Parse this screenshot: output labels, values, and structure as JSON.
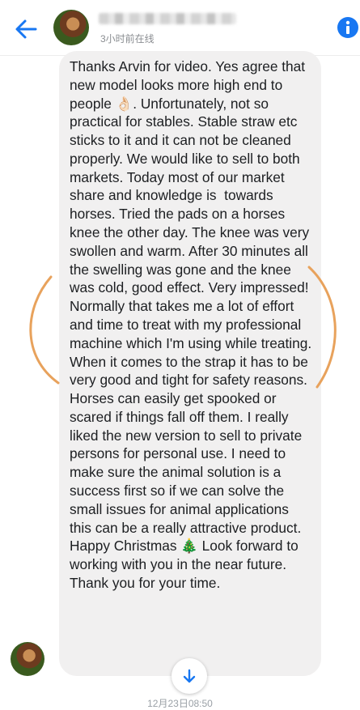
{
  "header": {
    "status": "3小时前在线",
    "back_icon": "back-arrow-icon",
    "info_icon": "info-icon",
    "accent_color": "#1877f2"
  },
  "message": {
    "text": "Thanks Arvin for video. Yes agree that new model looks more high end to people 👌🏻. Unfortunately, not so practical for stables. Stable straw etc sticks to it and it can not be cleaned properly. We would like to sell to both markets. Today most of our market share and knowledge is  towards horses. Tried the pads on a horses knee the other day. The knee was very swollen and warm. After 30 minutes all the swelling was gone and the knee was cold, good effect. Very impressed! Normally that takes me a lot of effort and time to treat with my professional machine which I'm using while treating.\nWhen it comes to the strap it has to be very good and tight for safety reasons. Horses can easily get spooked or scared if things fall off them. I really liked the new version to sell to private persons for personal use. I need to make sure the animal solution is a success first so if we can solve the small issues for animal applications this can be a really attractive product. Happy Christmas 🎄 Look forward to working with you in the near future. Thank you for your time."
  },
  "footer": {
    "timestamp": "12月23日08:50",
    "scroll_icon": "arrow-down-icon"
  },
  "annotation_color": "#e8a25c"
}
